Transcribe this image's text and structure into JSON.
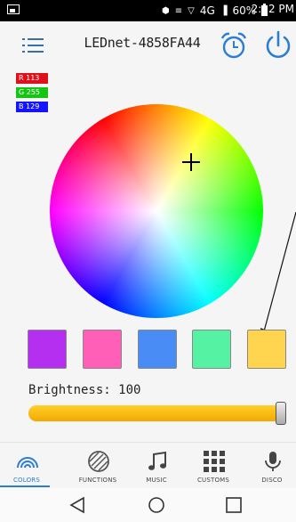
{
  "statusbar": {
    "network_text": "4G",
    "battery_text": "60%",
    "time": "2:12 PM"
  },
  "header": {
    "title": "LEDnet-4858FA44"
  },
  "rgb": {
    "r_label": "R 113",
    "g_label": "G 255",
    "b_label": "B 129"
  },
  "swatches": [
    {
      "color": "#b52ff0"
    },
    {
      "color": "#ff5fb7"
    },
    {
      "color": "#4a8cf5"
    },
    {
      "color": "#55f2a4"
    },
    {
      "color": "#ffd54f"
    }
  ],
  "brightness": {
    "label": "Brightness: 100",
    "value": 100,
    "max": 100
  },
  "nav": {
    "items": [
      {
        "label": "COLORS",
        "icon": "rainbow-icon"
      },
      {
        "label": "FUNCTIONS",
        "icon": "striped-circle-icon"
      },
      {
        "label": "MUSIC",
        "icon": "music-note-icon"
      },
      {
        "label": "CUSTOMS",
        "icon": "grid-icon"
      },
      {
        "label": "DISCO",
        "icon": "microphone-icon"
      }
    ],
    "active": "COLORS"
  },
  "colors": {
    "accent": "#2b7ed3",
    "header_icons": "#2b7ed3",
    "slider": "#f2b705"
  }
}
